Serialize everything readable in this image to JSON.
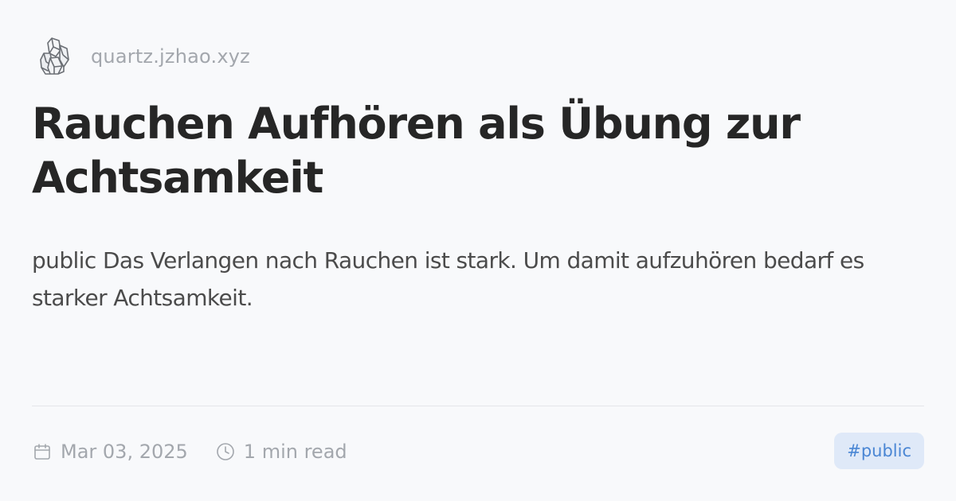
{
  "site": {
    "url": "quartz.jzhao.xyz",
    "logo_icon": "crystal-icon"
  },
  "article": {
    "title": "Rauchen Aufhören als Übung zur Achtsamkeit",
    "description": "public Das Verlangen nach Rauchen ist stark. Um damit aufzuhören bedarf es starker Achtsamkeit."
  },
  "meta": {
    "date": "Mar 03, 2025",
    "date_icon": "calendar-icon",
    "reading_time": "1 min read",
    "reading_time_icon": "clock-icon"
  },
  "tags": [
    {
      "label": "#public"
    }
  ],
  "colors": {
    "background": "#f8f9fb",
    "title": "#262626",
    "muted": "#a3a7ad",
    "tag_background": "#dfe9f8",
    "tag_text": "#4a86d4"
  }
}
